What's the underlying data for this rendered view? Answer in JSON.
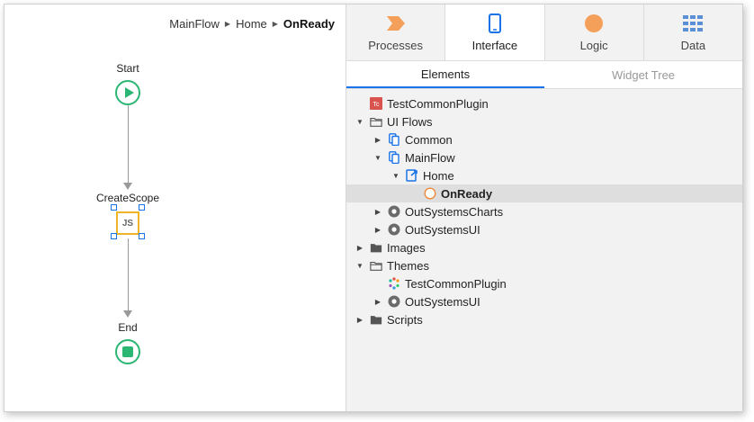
{
  "breadcrumb": {
    "items": [
      "MainFlow",
      "Home",
      "OnReady"
    ]
  },
  "flow": {
    "start_label": "Start",
    "action_label": "CreateScope",
    "action_badge": "JS",
    "end_label": "End"
  },
  "tabs": [
    {
      "label": "Processes",
      "icon": "processes-icon"
    },
    {
      "label": "Interface",
      "icon": "interface-icon"
    },
    {
      "label": "Logic",
      "icon": "logic-icon"
    },
    {
      "label": "Data",
      "icon": "data-icon"
    }
  ],
  "subtabs": [
    "Elements",
    "Widget Tree"
  ],
  "tree": [
    {
      "label": "TestCommonPlugin",
      "icon": "app-icon",
      "depth": 0,
      "caret": "none"
    },
    {
      "label": "UI Flows",
      "icon": "folder-open-icon",
      "depth": 0,
      "caret": "down"
    },
    {
      "label": "Common",
      "icon": "flow-icon",
      "depth": 1,
      "caret": "right"
    },
    {
      "label": "MainFlow",
      "icon": "flow-icon",
      "depth": 1,
      "caret": "down"
    },
    {
      "label": "Home",
      "icon": "screen-icon",
      "depth": 2,
      "caret": "down"
    },
    {
      "label": "OnReady",
      "icon": "event-icon",
      "depth": 3,
      "caret": "none",
      "selected": true
    },
    {
      "label": "OutSystemsCharts",
      "icon": "module-icon",
      "depth": 1,
      "caret": "right"
    },
    {
      "label": "OutSystemsUI",
      "icon": "module-icon",
      "depth": 1,
      "caret": "right"
    },
    {
      "label": "Images",
      "icon": "folder-icon",
      "depth": 0,
      "caret": "right"
    },
    {
      "label": "Themes",
      "icon": "folder-open-icon",
      "depth": 0,
      "caret": "down"
    },
    {
      "label": "TestCommonPlugin",
      "icon": "theme-icon",
      "depth": 1,
      "caret": "none"
    },
    {
      "label": "OutSystemsUI",
      "icon": "module-icon",
      "depth": 1,
      "caret": "right"
    },
    {
      "label": "Scripts",
      "icon": "folder-icon",
      "depth": 0,
      "caret": "right"
    }
  ],
  "colors": {
    "accent": "#1a73e8",
    "flow_green": "#2bb673",
    "js_border": "#f0b429",
    "processes_orange": "#f5a05a",
    "logic_orange": "#f5a05a",
    "app_badge_red": "#d9534f"
  }
}
